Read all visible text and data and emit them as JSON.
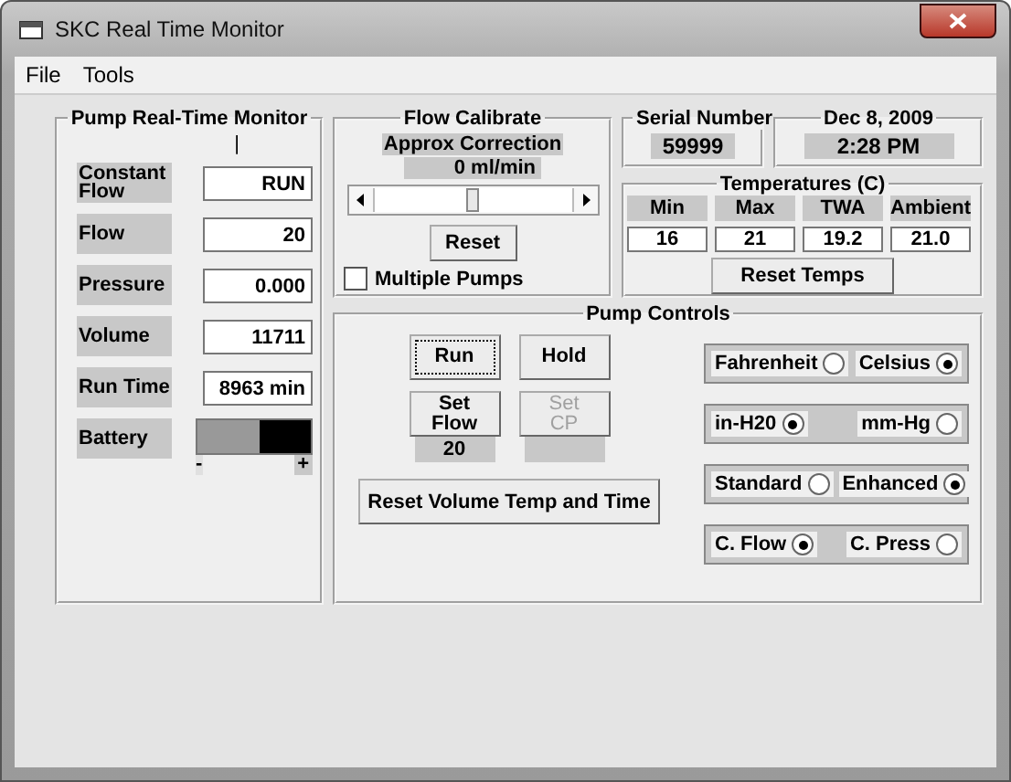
{
  "window": {
    "title": "SKC Real Time Monitor"
  },
  "menu": [
    "File",
    "Tools"
  ],
  "monitor": {
    "title": "Pump Real-Time Monitor",
    "marker": "|",
    "fields": [
      {
        "label": "Constant Flow",
        "value": "RUN"
      },
      {
        "label": "Flow",
        "value": "20"
      },
      {
        "label": "Pressure",
        "value": "0.000"
      },
      {
        "label": "Volume",
        "value": "11711"
      },
      {
        "label": "Run Time",
        "value": "8963 min"
      }
    ],
    "battery": {
      "label": "Battery",
      "level": 0.55,
      "minus": "-",
      "plus": "+"
    }
  },
  "flow_calibrate": {
    "title": "Flow Calibrate",
    "caption": "Approx Correction",
    "reading": "0 ml/min",
    "slider": {
      "level": 0.5
    },
    "reset": "Reset",
    "multiple_pumps": {
      "label": "Multiple Pumps",
      "checked": false
    }
  },
  "serial": {
    "title": "Serial Number",
    "value": "59999"
  },
  "datetime": {
    "date": "Dec 8, 2009",
    "time": "2:28 PM"
  },
  "temperatures": {
    "title": "Temperatures (C)",
    "columns": [
      {
        "label": "Min",
        "value": "16"
      },
      {
        "label": "Max",
        "value": "21"
      },
      {
        "label": "TWA",
        "value": "19.2"
      },
      {
        "label": "Ambient",
        "value": "21.0"
      }
    ],
    "reset": "Reset Temps"
  },
  "pump_controls": {
    "title": "Pump Controls",
    "buttons": [
      {
        "label": "Run",
        "disabled": false,
        "focused": true,
        "reading_box": false
      },
      {
        "label": "Hold",
        "disabled": false,
        "focused": false,
        "reading_box": false
      },
      {
        "label": "Set Flow",
        "disabled": false,
        "focused": false,
        "reading_box": true,
        "reading": "20"
      },
      {
        "label": "Set CP",
        "disabled": true,
        "focused": false,
        "reading_box": true
      }
    ],
    "reset": "Reset Volume Temp and Time",
    "radio_groups": [
      [
        {
          "label": "Fahrenheit",
          "selected": false
        },
        {
          "label": "Celsius",
          "selected": true
        }
      ],
      [
        {
          "label": "in-H20",
          "selected": true
        },
        {
          "label": "mm-Hg",
          "selected": false
        }
      ],
      [
        {
          "label": "Standard",
          "selected": false
        },
        {
          "label": "Enhanced",
          "selected": true
        }
      ],
      [
        {
          "label": "C. Flow",
          "selected": true
        },
        {
          "label": "C. Press",
          "selected": false
        }
      ]
    ]
  }
}
